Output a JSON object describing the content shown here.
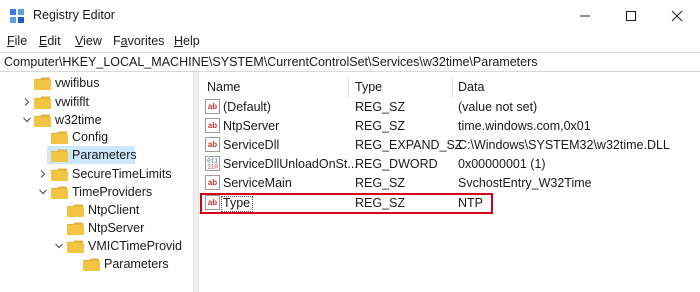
{
  "window": {
    "title": "Registry Editor",
    "app_icon": "registry-icon",
    "controls": [
      "minimize-icon",
      "maximize-icon",
      "close-icon"
    ]
  },
  "menu": [
    {
      "accel": "F",
      "rest": "ile"
    },
    {
      "accel": "E",
      "rest": "dit"
    },
    {
      "accel": "V",
      "rest": "iew"
    },
    {
      "pre": "F",
      "accel": "a",
      "rest": "vorites"
    },
    {
      "accel": "H",
      "rest": "elp"
    }
  ],
  "address": "Computer\\HKEY_LOCAL_MACHINE\\SYSTEM\\CurrentControlSet\\Services\\w32time\\Parameters",
  "tree": [
    {
      "label": "vwifibus",
      "expanded": null,
      "selected": false
    },
    {
      "label": "vwififlt",
      "expanded": false,
      "selected": false
    },
    {
      "label": "w32time",
      "expanded": true,
      "selected": false
    },
    {
      "label": "Config",
      "expanded": null,
      "selected": false
    },
    {
      "label": "Parameters",
      "expanded": null,
      "selected": true
    },
    {
      "label": "SecureTimeLimits",
      "expanded": false,
      "selected": false
    },
    {
      "label": "TimeProviders",
      "expanded": true,
      "selected": false
    },
    {
      "label": "NtpClient",
      "expanded": null,
      "selected": false
    },
    {
      "label": "NtpServer",
      "expanded": null,
      "selected": false
    },
    {
      "label": "VMICTimeProvid",
      "expanded": true,
      "selected": false
    },
    {
      "label": "Parameters",
      "expanded": null,
      "selected": false
    }
  ],
  "columns": {
    "name": "Name",
    "type": "Type",
    "data": "Data"
  },
  "values": [
    {
      "name": "(Default)",
      "type": "REG_SZ",
      "data": "(value not set)",
      "icon": "string-value-icon"
    },
    {
      "name": "NtpServer",
      "type": "REG_SZ",
      "data": "time.windows.com,0x01",
      "icon": "string-value-icon"
    },
    {
      "name": "ServiceDll",
      "type": "REG_EXPAND_SZ",
      "data": "C:\\Windows\\SYSTEM32\\w32time.DLL",
      "icon": "string-value-icon"
    },
    {
      "name": "ServiceDllUnloadOnSt...",
      "type": "REG_DWORD",
      "data": "0x00000001 (1)",
      "icon": "binary-value-icon"
    },
    {
      "name": "ServiceMain",
      "type": "REG_SZ",
      "data": "SvchostEntry_W32Time",
      "icon": "string-value-icon"
    },
    {
      "name": "Type",
      "type": "REG_SZ",
      "data": "NTP",
      "icon": "string-value-icon",
      "highlighted": true
    }
  ],
  "colors": {
    "selection": "#cce8ff",
    "highlight_border": "#d0021b",
    "folder": "#f4c542",
    "string_icon": "#c0392b",
    "binary_icon": "#2c5aa0"
  }
}
